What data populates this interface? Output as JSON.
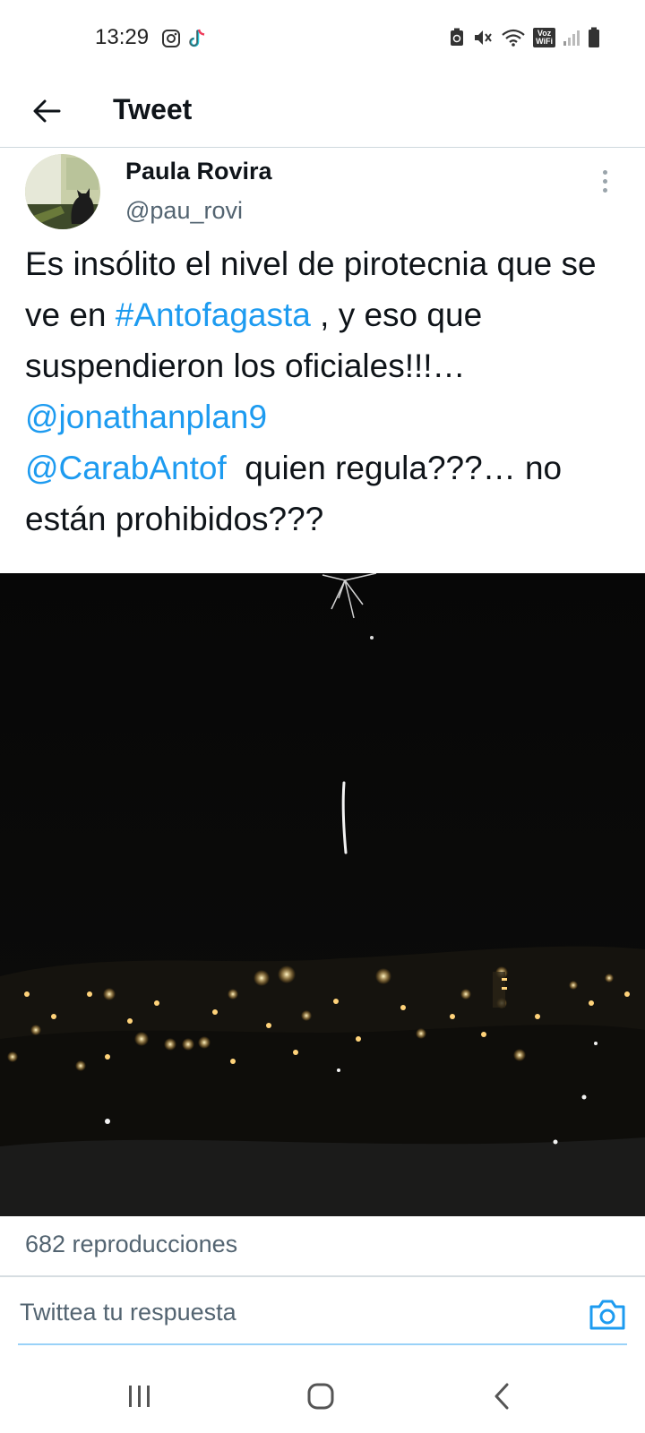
{
  "status_bar": {
    "time": "13:29",
    "left_icons": [
      "instagram-icon",
      "tiktok-icon"
    ],
    "right_icons": [
      "battery-saver-icon",
      "mute-icon",
      "wifi-icon",
      "voz-wifi-icon",
      "signal-icon",
      "battery-icon"
    ],
    "voz_wifi_top": "Voz",
    "voz_wifi_bottom": "WiFi"
  },
  "top_bar": {
    "back_icon": "arrow-left-icon",
    "title": "Tweet"
  },
  "tweet": {
    "author_name": "Paula Rovira",
    "author_handle": "@pau_rovi",
    "text_part1": "Es insólito el nivel de pirotecnia que se ve en ",
    "hashtag": "#Antofagasta",
    "text_part2": " , y eso que suspendieron los oficiales!!!… ",
    "mention1": "@jonathanplan9",
    "mention2": "@CarabAntof",
    "text_part3": "  quien regula???… no están prohibidos???",
    "views": "682 reproducciones"
  },
  "reply": {
    "placeholder": "Twittea tu respuesta",
    "camera_icon": "camera-icon"
  },
  "nav_bar": {
    "icons": [
      "recent-apps-icon",
      "home-icon",
      "back-icon"
    ]
  },
  "colors": {
    "link": "#1d9bf0",
    "text": "#0f1419",
    "secondary": "#536471",
    "divider": "#cfd9de"
  }
}
